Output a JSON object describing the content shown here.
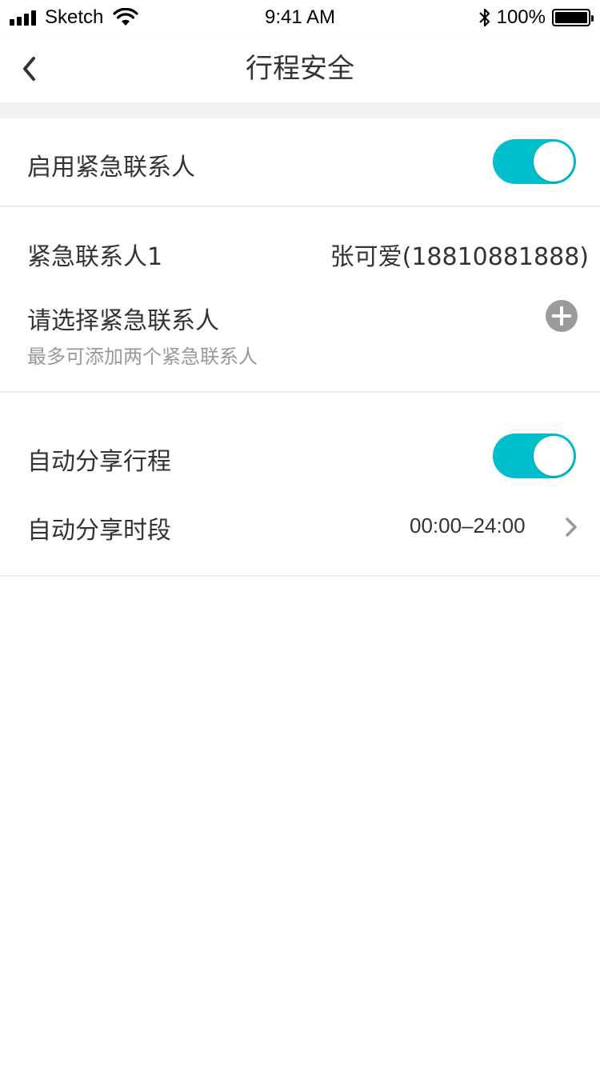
{
  "status_bar": {
    "carrier": "Sketch",
    "time": "9:41 AM",
    "battery": "100%"
  },
  "nav": {
    "title": "行程安全"
  },
  "emergency": {
    "enable_label": "启用紧急联系人",
    "enabled": true,
    "contact1_label": "紧急联系人1",
    "contact1_value": "张可爱(18810881888)",
    "select_label": "请选择紧急联系人",
    "select_hint": "最多可添加两个紧急联系人"
  },
  "share": {
    "auto_share_label": "自动分享行程",
    "auto_share_enabled": true,
    "period_label": "自动分享时段",
    "period_value": "00:00–24:00"
  },
  "colors": {
    "accent": "#00bfcc",
    "text": "#333333",
    "hint": "#999999"
  }
}
